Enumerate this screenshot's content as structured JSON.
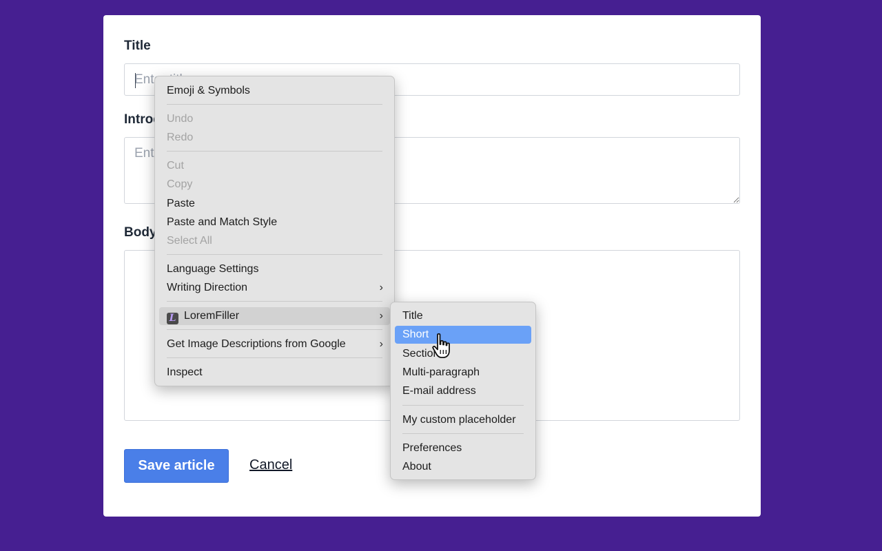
{
  "form": {
    "title_label": "Title",
    "title_placeholder": "Enter title",
    "intro_label": "Introduction",
    "intro_placeholder": "Enter introduction",
    "body_label": "Body",
    "body_placeholder": "",
    "save_label": "Save article",
    "cancel_label": "Cancel"
  },
  "context_menu": {
    "items": [
      {
        "label": "Emoji & Symbols",
        "enabled": true
      },
      {
        "label": "Undo",
        "enabled": false
      },
      {
        "label": "Redo",
        "enabled": false
      },
      {
        "label": "Cut",
        "enabled": false
      },
      {
        "label": "Copy",
        "enabled": false
      },
      {
        "label": "Paste",
        "enabled": true
      },
      {
        "label": "Paste and Match Style",
        "enabled": true
      },
      {
        "label": "Select All",
        "enabled": false
      },
      {
        "label": "Language Settings",
        "enabled": true
      },
      {
        "label": "Writing Direction",
        "enabled": true,
        "submenu": true
      },
      {
        "label": "LoremFiller",
        "enabled": true,
        "submenu": true,
        "icon": "loremfiller-logo-icon",
        "icon_letter": "L"
      },
      {
        "label": "Get Image Descriptions from Google",
        "enabled": true,
        "submenu": true
      },
      {
        "label": "Inspect",
        "enabled": true
      }
    ],
    "chevron": "›"
  },
  "submenu": {
    "items": [
      {
        "label": "Title"
      },
      {
        "label": "Short",
        "highlighted": true
      },
      {
        "label": "Section"
      },
      {
        "label": "Multi-paragraph"
      },
      {
        "label": "E-mail address"
      },
      {
        "label": "My custom placeholder"
      },
      {
        "label": "Preferences"
      },
      {
        "label": "About"
      }
    ]
  },
  "colors": {
    "background": "#461f91",
    "primary_button": "#4a7fe8",
    "menu_highlight": "#6aa1f7"
  }
}
